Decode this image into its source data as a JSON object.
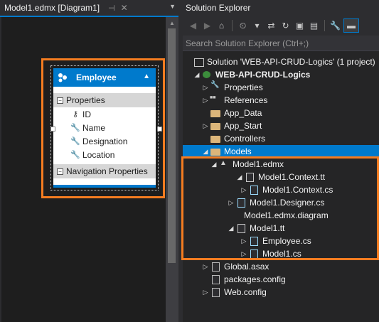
{
  "designer": {
    "tab_title": "Model1.edmx [Diagram1]",
    "pin_icon": "pin-icon",
    "close_icon": "close-icon",
    "entity": {
      "name": "Employee",
      "properties_label": "Properties",
      "properties": [
        {
          "name": "ID",
          "icon": "key-icon"
        },
        {
          "name": "Name",
          "icon": "wrench-icon"
        },
        {
          "name": "Designation",
          "icon": "wrench-icon"
        },
        {
          "name": "Location",
          "icon": "wrench-icon"
        }
      ],
      "nav_label": "Navigation Properties"
    }
  },
  "solution_explorer": {
    "title": "Solution Explorer",
    "search_placeholder": "Search Solution Explorer (Ctrl+;)",
    "tree": [
      {
        "label": "Solution 'WEB-API-CRUD-Logics' (1 project)",
        "icon": "solution-icon"
      },
      {
        "label": "WEB-API-CRUD-Logics",
        "icon": "project-icon"
      },
      {
        "label": "Properties",
        "icon": "wrench-icon"
      },
      {
        "label": "References",
        "icon": "references-icon"
      },
      {
        "label": "App_Data",
        "icon": "folder-icon"
      },
      {
        "label": "App_Start",
        "icon": "folder-icon"
      },
      {
        "label": "Controllers",
        "icon": "folder-icon"
      },
      {
        "label": "Models",
        "icon": "folder-icon"
      },
      {
        "label": "Model1.edmx",
        "icon": "edmx-icon"
      },
      {
        "label": "Model1.Context.tt",
        "icon": "file-icon"
      },
      {
        "label": "Model1.Context.cs",
        "icon": "cs-file-icon"
      },
      {
        "label": "Model1.Designer.cs",
        "icon": "cs-file-icon"
      },
      {
        "label": "Model1.edmx.diagram",
        "icon": "file-icon"
      },
      {
        "label": "Model1.tt",
        "icon": "file-icon"
      },
      {
        "label": "Employee.cs",
        "icon": "cs-file-icon"
      },
      {
        "label": "Model1.cs",
        "icon": "cs-file-icon"
      },
      {
        "label": "Global.asax",
        "icon": "asax-file-icon"
      },
      {
        "label": "packages.config",
        "icon": "config-file-icon"
      },
      {
        "label": "Web.config",
        "icon": "config-file-icon"
      }
    ]
  },
  "colors": {
    "accent": "#007acc",
    "highlight": "#f47c20",
    "background": "#2d2d30"
  }
}
